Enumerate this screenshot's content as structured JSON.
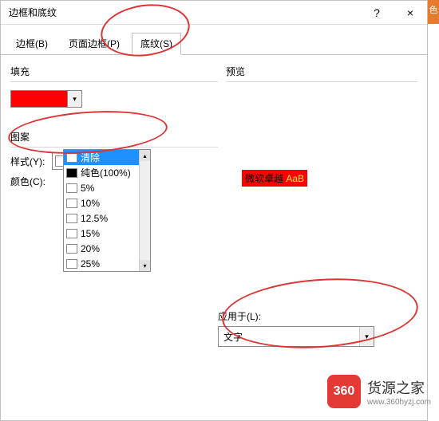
{
  "ribbon_hint": "色",
  "dialog": {
    "title": "边框和底纹",
    "help": "?",
    "close": "×"
  },
  "tabs": {
    "border": "边框(B)",
    "page_border": "页面边框(P)",
    "shading": "底纹(S)"
  },
  "left": {
    "fill_label": "填充",
    "fill_color": "#ff0000",
    "pattern_label": "图案",
    "style_label": "样式(Y):",
    "style_value": "清除",
    "color_label": "颜色(C):",
    "style_options": [
      {
        "label": "清除",
        "cls": "selected"
      },
      {
        "label": "纯色(100%)",
        "cls": "solid"
      },
      {
        "label": "5%",
        "cls": ""
      },
      {
        "label": "10%",
        "cls": ""
      },
      {
        "label": "12.5%",
        "cls": ""
      },
      {
        "label": "15%",
        "cls": ""
      },
      {
        "label": "20%",
        "cls": ""
      },
      {
        "label": "25%",
        "cls": ""
      }
    ]
  },
  "right": {
    "preview_label": "预览",
    "preview_sample_a": "微软卓越",
    "preview_sample_b": "AaB",
    "apply_label": "应用于(L):",
    "apply_value": "文字"
  },
  "watermark": {
    "logo": "360",
    "brand": "货源之家",
    "url": "www.360hyzj.com"
  }
}
